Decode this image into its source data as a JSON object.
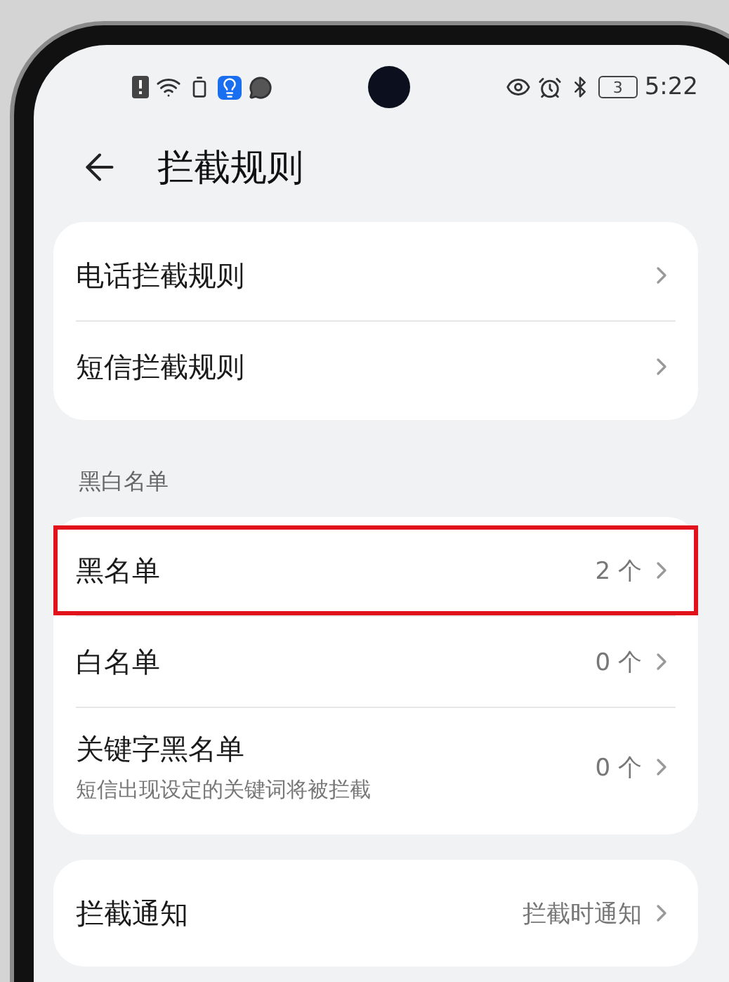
{
  "status_bar": {
    "battery": "3",
    "time": "5:22"
  },
  "header": {
    "title": "拦截规则"
  },
  "groups": [
    {
      "items": [
        {
          "label": "电话拦截规则",
          "highlighted": false
        },
        {
          "label": "短信拦截规则",
          "highlighted": false
        }
      ]
    },
    {
      "heading": "黑白名单",
      "items": [
        {
          "label": "黑名单",
          "value": "2 个",
          "highlighted": true
        },
        {
          "label": "白名单",
          "value": "0 个",
          "highlighted": false
        },
        {
          "label": "关键字黑名单",
          "subtitle": "短信出现设定的关键词将被拦截",
          "value": "0 个",
          "highlighted": false
        }
      ]
    },
    {
      "items": [
        {
          "label": "拦截通知",
          "value": "拦截时通知",
          "highlighted": false
        }
      ]
    }
  ]
}
